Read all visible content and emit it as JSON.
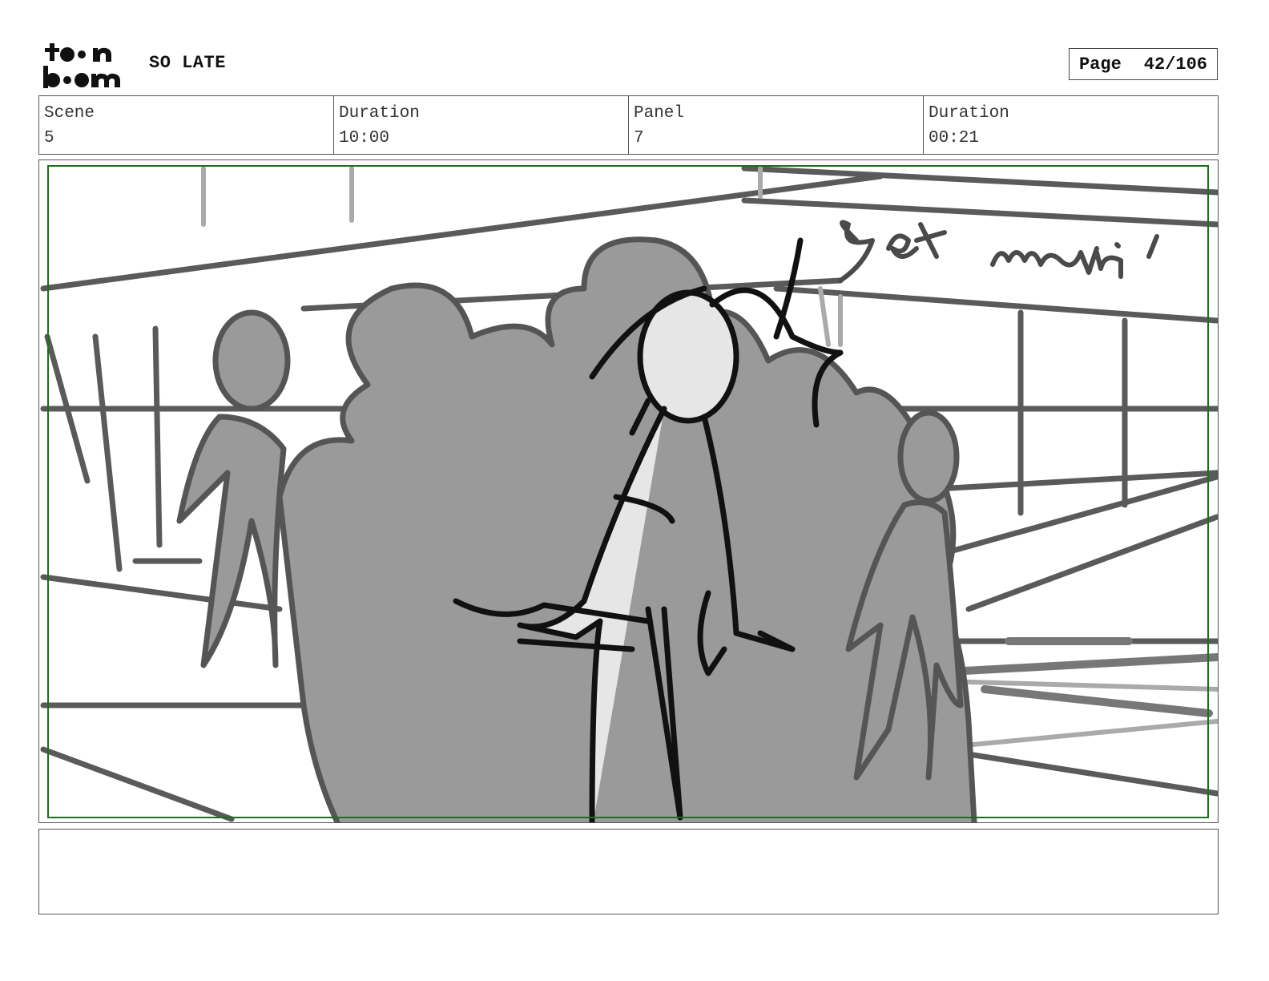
{
  "header": {
    "logo_text": "toon boom",
    "project_title": "SO LATE",
    "page_label": "Page",
    "page_number": "42/106"
  },
  "info": {
    "scene_label": "Scene",
    "scene_value": "5",
    "scene_duration_label": "Duration",
    "scene_duration_value": "10:00",
    "panel_label": "Panel",
    "panel_value": "7",
    "panel_duration_label": "Duration",
    "panel_duration_value": "00:21"
  },
  "panel": {
    "sign_text": "get movin'",
    "safe_frame_color": "#1f6e1f",
    "sketch_colors": {
      "line": "#5a5a5a",
      "crowd": "#9a9a9a",
      "figure": "#e6e6e6",
      "ink": "#111111"
    }
  },
  "notes": {
    "text": ""
  }
}
